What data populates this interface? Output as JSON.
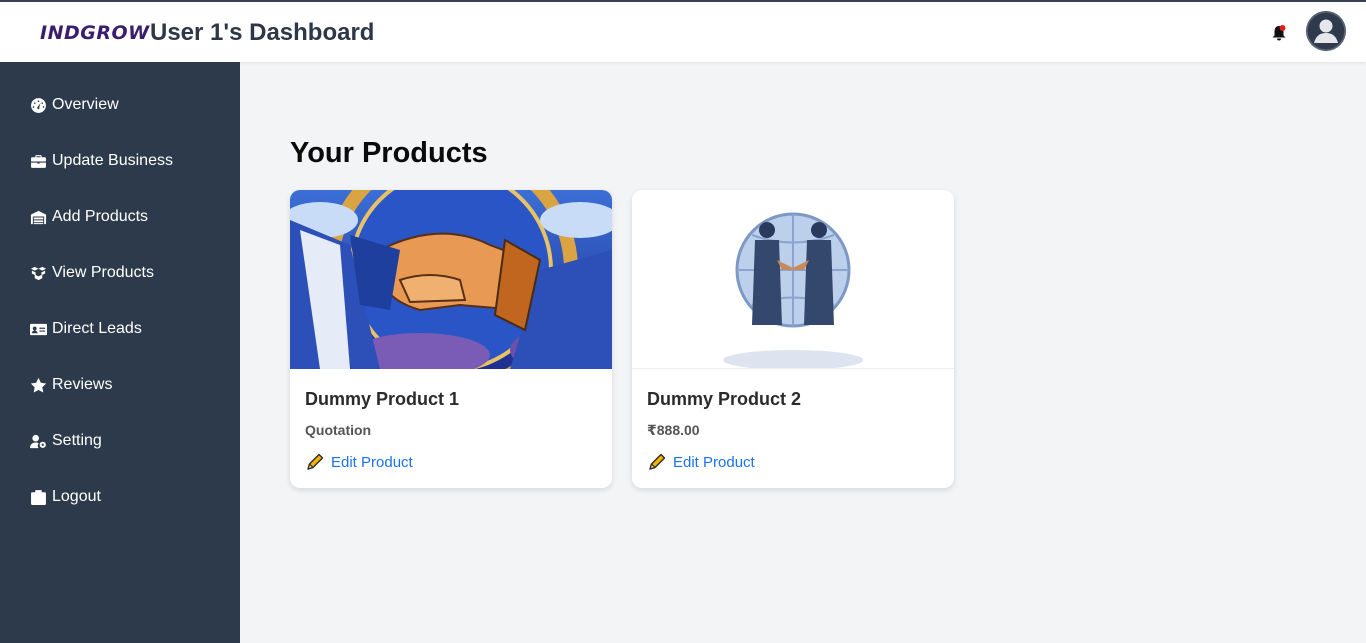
{
  "header": {
    "logo_text": "INDGROW",
    "title": "User 1's Dashboard",
    "notification_icon": "bell-icon",
    "avatar_icon": "user-avatar-icon"
  },
  "sidebar": {
    "items": [
      {
        "label": "Overview",
        "icon": "dashboard-icon"
      },
      {
        "label": "Update Business",
        "icon": "briefcase-icon"
      },
      {
        "label": "Add Products",
        "icon": "warehouse-icon"
      },
      {
        "label": "View Products",
        "icon": "boxes-icon"
      },
      {
        "label": "Direct Leads",
        "icon": "id-card-icon"
      },
      {
        "label": "Reviews",
        "icon": "star-icon"
      },
      {
        "label": "Setting",
        "icon": "user-gear-icon"
      },
      {
        "label": "Logout",
        "icon": "logout-icon"
      }
    ]
  },
  "main": {
    "page_title": "Your Products",
    "products": [
      {
        "name": "Dummy Product 1",
        "price": "Quotation",
        "edit_label": "Edit Product",
        "image": "handshake-stained-glass-image"
      },
      {
        "name": "Dummy Product 2",
        "price": "₹888.00",
        "edit_label": "Edit Product",
        "image": "indgrow-globe-handshake-image"
      }
    ]
  },
  "colors": {
    "sidebar_bg": "#2d3a4b",
    "link_blue": "#1a73e8",
    "page_bg": "#f3f4f6",
    "bell_dot": "#e11d1d"
  }
}
